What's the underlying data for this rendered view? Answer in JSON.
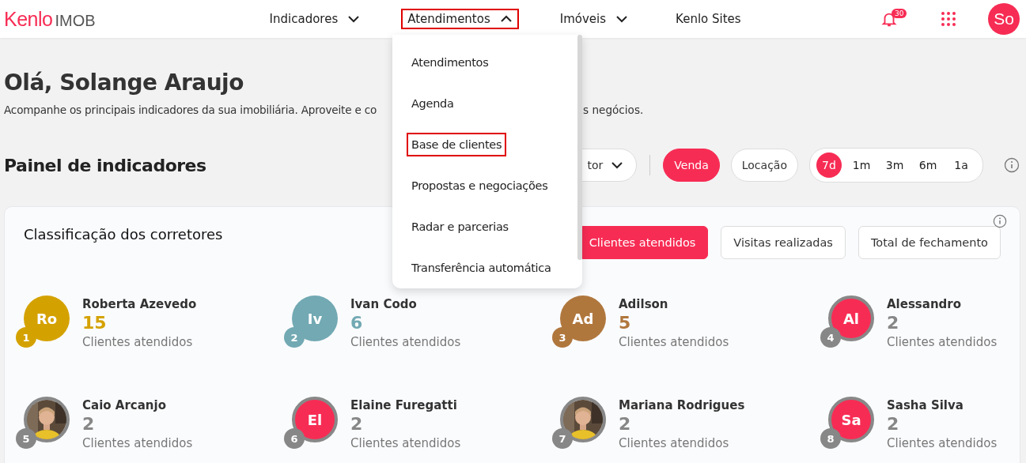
{
  "header": {
    "logo_brand": "Kenlo",
    "logo_product": "IMOB",
    "nav": [
      {
        "label": "Indicadores",
        "kind": "menu",
        "expanded": false,
        "highlighted": false
      },
      {
        "label": "Atendimentos",
        "kind": "menu",
        "expanded": true,
        "highlighted": true
      },
      {
        "label": "Imóveis",
        "kind": "menu",
        "expanded": false,
        "highlighted": false
      },
      {
        "label": "Kenlo Sites",
        "kind": "link",
        "highlighted": false
      }
    ],
    "notifications": "30",
    "user_initials": "So"
  },
  "dropdown": {
    "items": [
      {
        "label": "Atendimentos",
        "highlighted": false
      },
      {
        "label": "Agenda",
        "highlighted": false
      },
      {
        "label": "Base de clientes",
        "highlighted": true
      },
      {
        "label": "Propostas e negociações",
        "highlighted": false
      },
      {
        "label": "Radar e parcerias",
        "highlighted": false
      },
      {
        "label": "Transferência automática",
        "highlighted": false
      }
    ]
  },
  "greeting": "Olá, Solange Araujo",
  "subtitle_start": "Acompanhe os principais indicadores da sua imobiliária. Aproveite e co",
  "subtitle_end": "s negócios.",
  "panel": {
    "title": "Painel de indicadores",
    "filter_label": "tor",
    "business": [
      {
        "label": "Venda",
        "selected": true
      },
      {
        "label": "Locação",
        "selected": false
      }
    ],
    "periods": [
      {
        "label": "7d",
        "selected": true
      },
      {
        "label": "1m",
        "selected": false
      },
      {
        "label": "3m",
        "selected": false
      },
      {
        "label": "6m",
        "selected": false
      },
      {
        "label": "1a",
        "selected": false
      }
    ]
  },
  "ranking": {
    "title": "Classificação dos corretores",
    "tabs": [
      {
        "label": "Clientes atendidos",
        "selected": true
      },
      {
        "label": "Visitas realizadas",
        "selected": false
      },
      {
        "label": "Total de fechamento",
        "selected": false
      }
    ],
    "brokers": [
      {
        "rank": "1",
        "name": "Roberta Azevedo",
        "count": "15",
        "caption": "Clientes atendidos",
        "color": "#d4a200",
        "avatar": {
          "kind": "initials",
          "text": "Ro",
          "color": "#d4a200"
        }
      },
      {
        "rank": "2",
        "name": "Ivan Codo",
        "count": "6",
        "caption": "Clientes atendidos",
        "color": "#72a9b3",
        "avatar": {
          "kind": "initials",
          "text": "Iv",
          "color": "#72a9b3"
        }
      },
      {
        "rank": "3",
        "name": "Adilson",
        "count": "5",
        "caption": "Clientes atendidos",
        "color": "#b0773d",
        "avatar": {
          "kind": "initials",
          "text": "Ad",
          "color": "#b0773d"
        }
      },
      {
        "rank": "4",
        "name": "Alessandro",
        "count": "2",
        "caption": "Clientes atendidos",
        "color": "#878787",
        "avatar": {
          "kind": "initials",
          "text": "Al",
          "color": "#f72c54"
        }
      },
      {
        "rank": "5",
        "name": "Caio Arcanjo",
        "count": "2",
        "caption": "Clientes atendidos",
        "color": "#878787"
      },
      {
        "rank": "6",
        "name": "Elaine Furegatti",
        "count": "2",
        "caption": "Clientes atendidos",
        "color": "#878787",
        "avatar": {
          "kind": "initials",
          "text": "El",
          "color": "#f72c54"
        }
      },
      {
        "rank": "7",
        "name": "Mariana Rodrigues",
        "count": "2",
        "caption": "Clientes atendidos",
        "color": "#878787"
      },
      {
        "rank": "8",
        "name": "Sasha Silva",
        "count": "2",
        "caption": "Clientes atendidos",
        "color": "#878787",
        "avatar": {
          "kind": "initials",
          "text": "Sa",
          "color": "#f72c54"
        }
      }
    ]
  }
}
